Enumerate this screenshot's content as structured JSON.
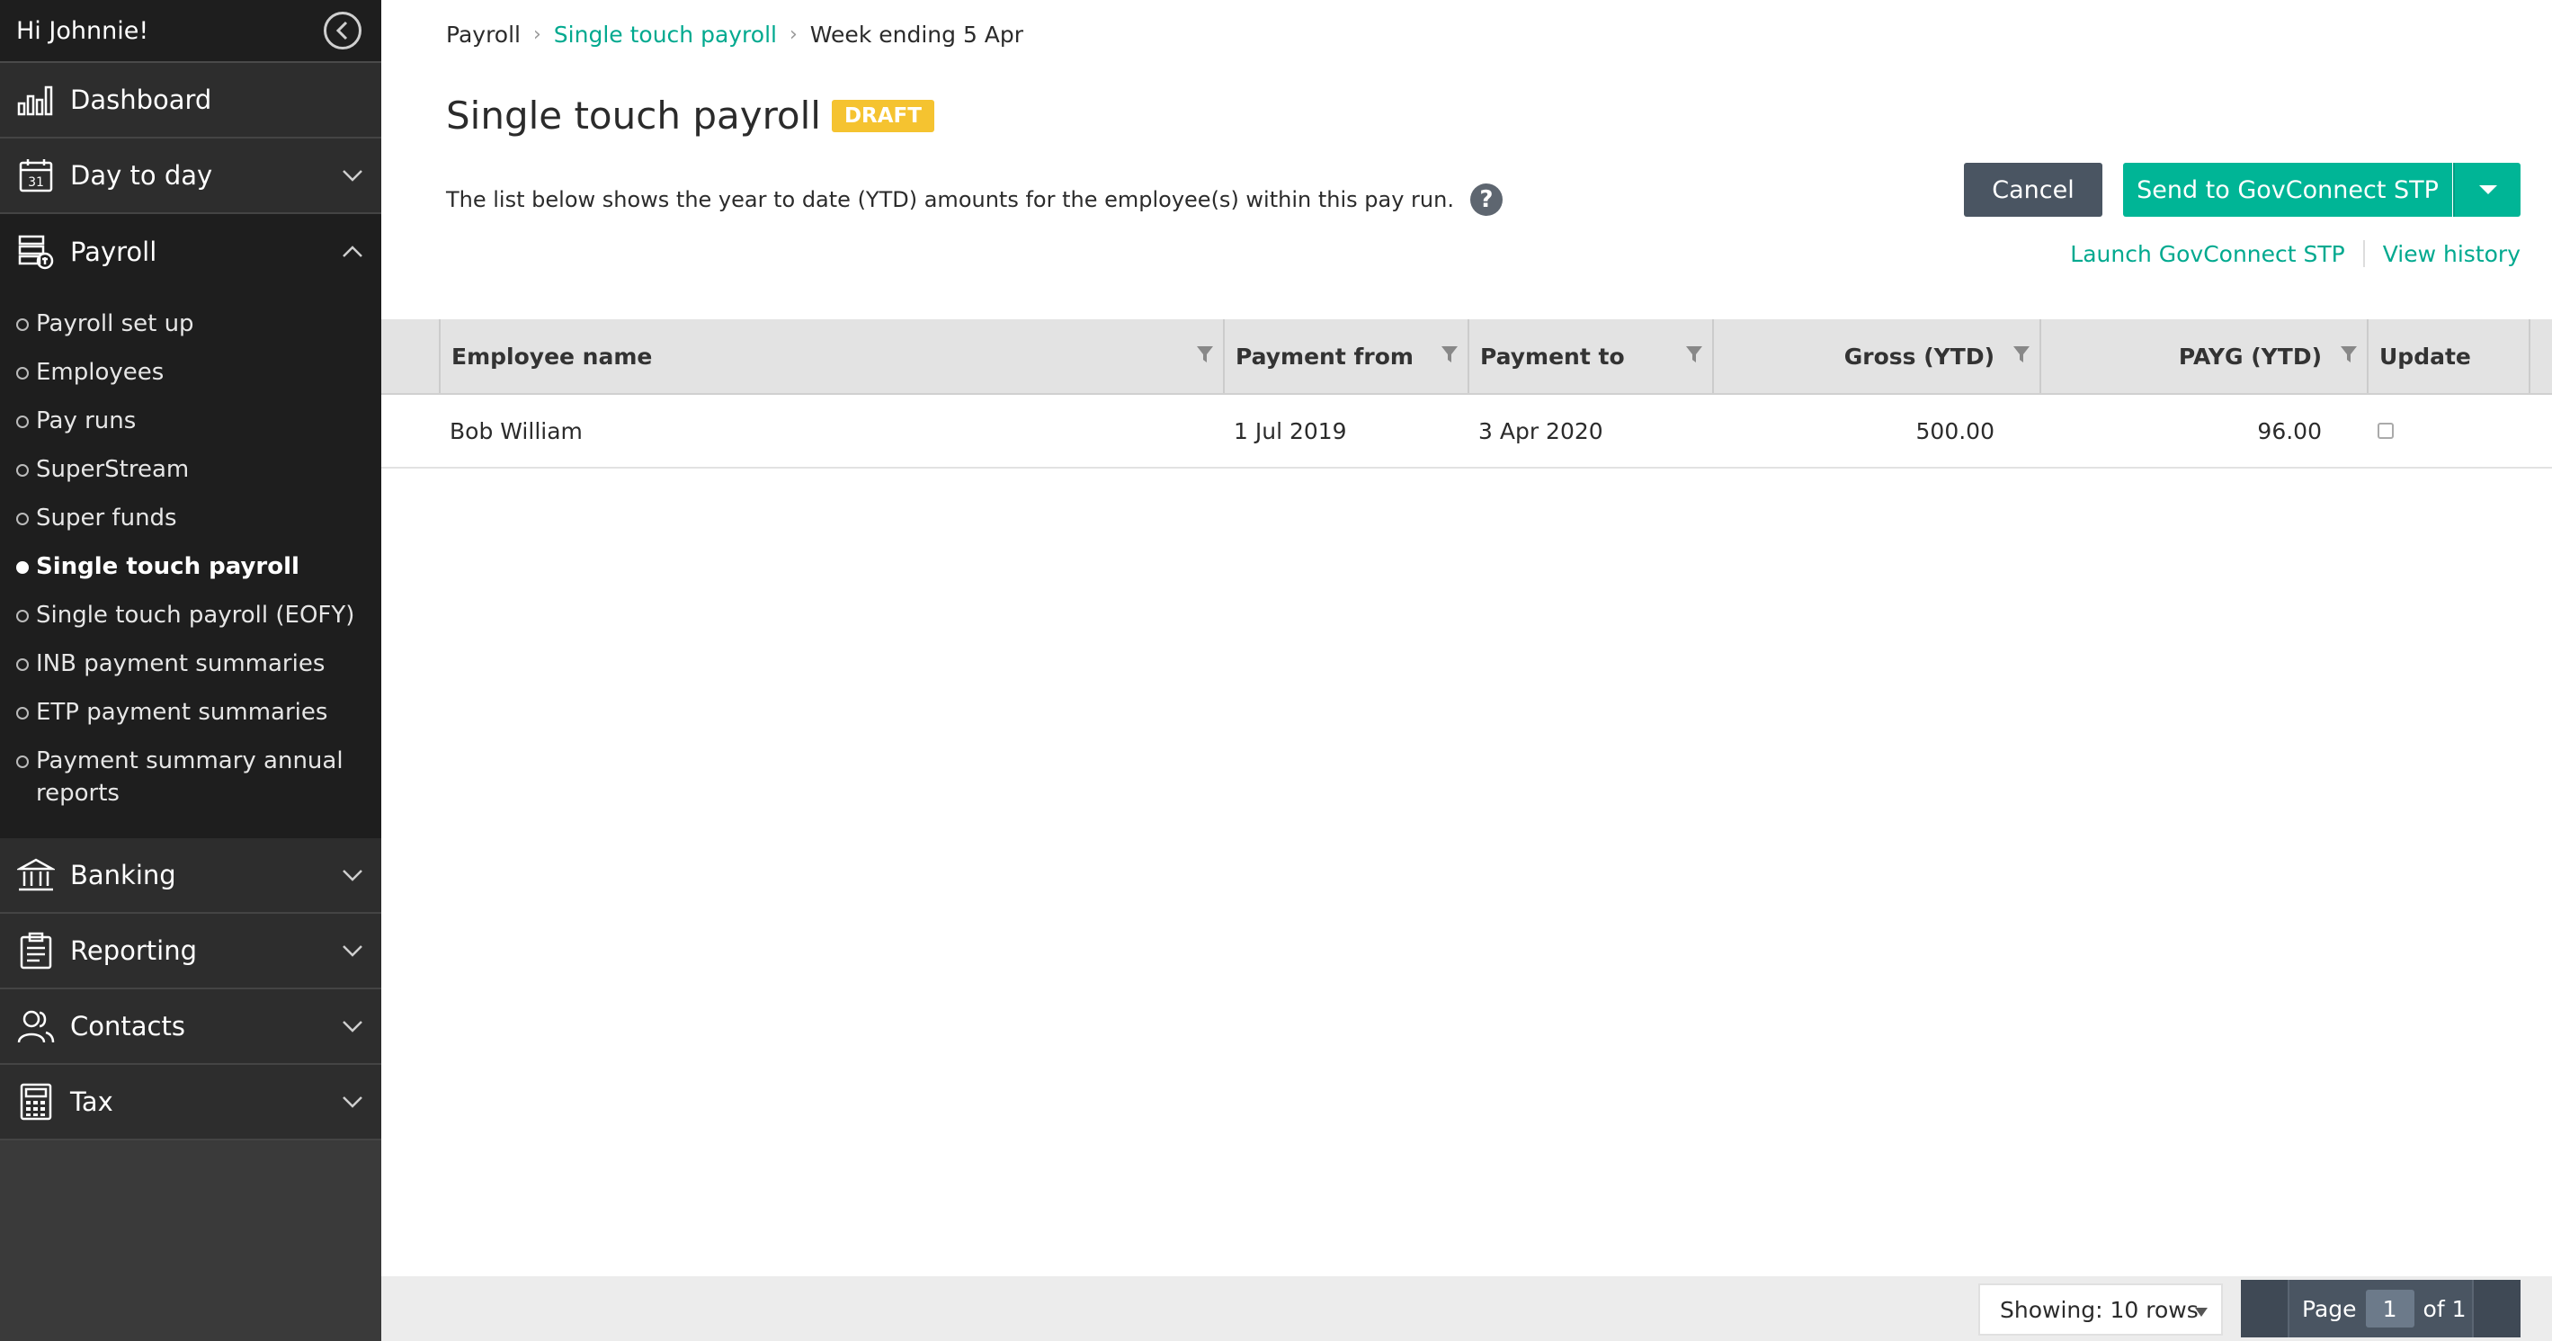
{
  "sidebar": {
    "greeting": "Hi Johnnie!",
    "menu": {
      "dashboard": "Dashboard",
      "day_to_day": "Day to day",
      "payroll": "Payroll",
      "banking": "Banking",
      "reporting": "Reporting",
      "contacts": "Contacts",
      "tax": "Tax"
    },
    "payroll_sub": [
      "Payroll set up",
      "Employees",
      "Pay runs",
      "SuperStream",
      "Super funds",
      "Single touch payroll",
      "Single touch payroll (EOFY)",
      "INB payment summaries",
      "ETP payment summaries",
      "Payment summary annual reports"
    ],
    "active_sub": "Single touch payroll",
    "calendar_day": "31"
  },
  "breadcrumb": {
    "root": "Payroll",
    "link": "Single touch payroll",
    "current": "Week ending 5 Apr"
  },
  "page": {
    "title": "Single touch payroll",
    "status_badge": "DRAFT",
    "description": "The list below shows the year to date (YTD) amounts for the employee(s) within this pay run.",
    "help": "?"
  },
  "actions": {
    "cancel": "Cancel",
    "send": "Send to GovConnect STP",
    "launch": "Launch GovConnect STP",
    "history": "View history"
  },
  "table": {
    "columns": {
      "employee_name": "Employee name",
      "payment_from": "Payment from",
      "payment_to": "Payment to",
      "gross_ytd": "Gross (YTD)",
      "payg_ytd": "PAYG (YTD)",
      "update": "Update"
    },
    "rows": [
      {
        "employee_name": "Bob William",
        "payment_from": "1 Jul 2019",
        "payment_to": "3 Apr 2020",
        "gross_ytd": "500.00",
        "payg_ytd": "96.00",
        "update": false
      }
    ]
  },
  "footer": {
    "showing": "Showing: 10 rows",
    "page_label": "Page",
    "page_current": "1",
    "page_total": "of 1"
  },
  "colors": {
    "accent": "#00b596",
    "link": "#00a98f",
    "badge": "#f5c330",
    "sidebar": "#3a3a3a"
  }
}
